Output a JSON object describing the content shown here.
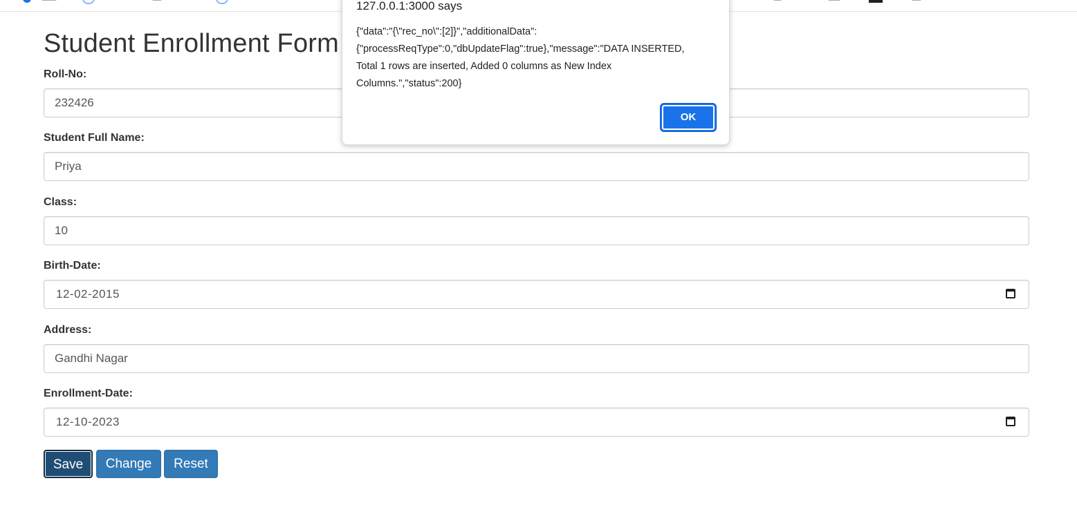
{
  "form": {
    "title": "Student Enrollment Form",
    "fields": [
      {
        "label": "Roll-No:",
        "value": "232426"
      },
      {
        "label": "Student Full Name:",
        "value": "Priya"
      },
      {
        "label": "Class:",
        "value": "10"
      },
      {
        "label": "Birth-Date:",
        "value": "12-02-2015"
      },
      {
        "label": "Address:",
        "value": "Gandhi Nagar"
      },
      {
        "label": "Enrollment-Date:",
        "value": "12-10-2023"
      }
    ],
    "buttons": {
      "save": "Save",
      "change": "Change",
      "reset": "Reset"
    }
  },
  "dialog": {
    "title": "127.0.0.1:3000 says",
    "message": "{\"data\":\"{\\\"rec_no\\\":[2]}\",\"additionalData\":\n{\"processReqType\":0,\"dbUpdateFlag\":true},\"message\":\"DATA INSERTED,\nTotal 1 rows are inserted, Added 0 columns as New Index\nColumns.\",\"status\":200}",
    "ok_label": "OK"
  },
  "colors": {
    "primary": "#337ab7",
    "primary_active": "#204d74",
    "dialog_ok": "#1a73e8"
  },
  "icons": [
    "calendar-icon",
    "bookmark-person-icon",
    "bookmark-gear-icon"
  ]
}
